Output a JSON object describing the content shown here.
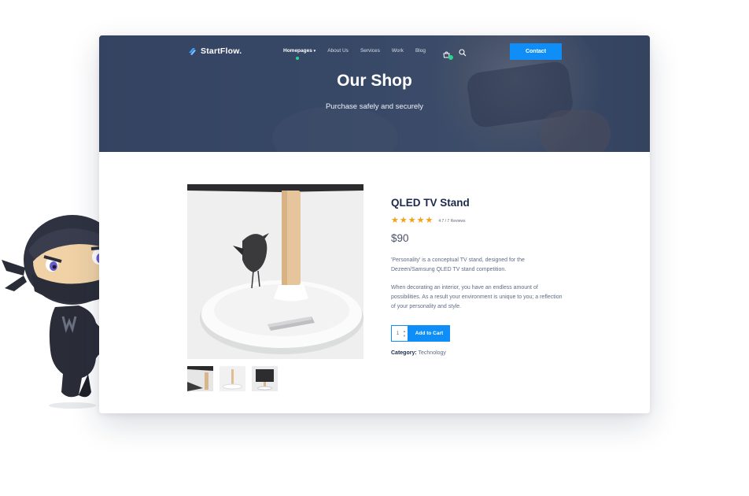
{
  "brand": {
    "name": "StartFlow."
  },
  "nav": {
    "items": [
      {
        "label": "Homepages",
        "active": true
      },
      {
        "label": "About Us"
      },
      {
        "label": "Services"
      },
      {
        "label": "Work"
      },
      {
        "label": "Blog"
      }
    ],
    "contact_label": "Contact"
  },
  "hero": {
    "title": "Our Shop",
    "subtitle": "Purchase safely and securely"
  },
  "product": {
    "title": "QLED TV Stand",
    "stars": "★★★★★",
    "rating_text": "4.7 / 7 Reviews",
    "price": "$90",
    "description_1": "'Personality' is a conceptual TV stand, designed for the Dezeen/Samsung QLED TV stand competition.",
    "description_2": "When decorating an interior, you have an endless amount of possibilities. As a result your environment is unique to you; a reflection of your personality and style.",
    "quantity": "1",
    "add_to_cart_label": "Add to Cart",
    "category_label": "Category:",
    "category_value": "Technology"
  },
  "colors": {
    "accent": "#0e8ef6",
    "title": "#1d2a4b",
    "star": "#f2a11a",
    "badge": "#2bd48c"
  },
  "icons": [
    "startflow-logo-icon",
    "chevron-down-icon",
    "cart-icon",
    "search-icon",
    "ninja-mascot"
  ]
}
